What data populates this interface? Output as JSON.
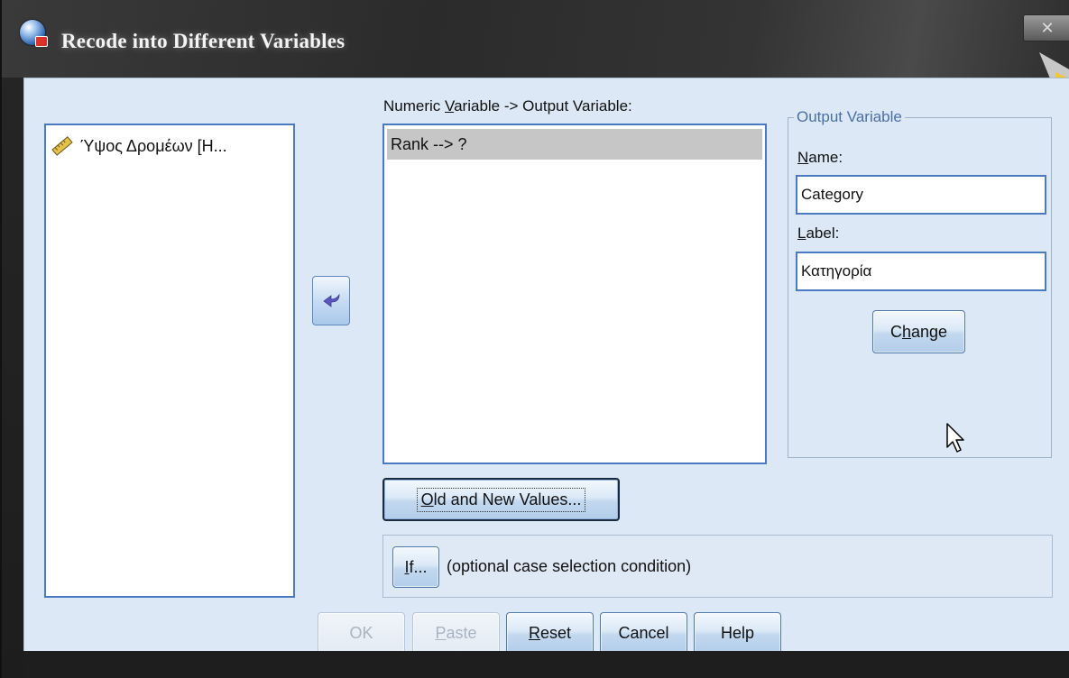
{
  "window": {
    "title": "Recode into Different Variables",
    "close_label": "✕"
  },
  "source_list": {
    "items": [
      {
        "label": "Ύψος Δρομέων [H...",
        "icon": "scale-ruler-icon"
      }
    ]
  },
  "mapping": {
    "header_before": "Numeric ",
    "header_mnemonic": "V",
    "header_after": "ariable -> Output Variable:",
    "rows": [
      "Rank --> ?"
    ]
  },
  "output_variable": {
    "group_title": "Output Variable",
    "name_mnemonic": "N",
    "name_rest": "ame:",
    "name_value": "Category",
    "label_mnemonic": "L",
    "label_rest": "abel:",
    "label_value": "Κατηγορία",
    "change_pre": "C",
    "change_mnemonic": "h",
    "change_post": "ange"
  },
  "buttons": {
    "old_new_mnemonic": "O",
    "old_new_rest": "ld and New Values...",
    "if_mnemonic": "I",
    "if_rest": "f...",
    "if_caption": "(optional case selection condition)",
    "ok": "OK",
    "paste_mnemonic": "P",
    "paste_rest": "aste",
    "reset_mnemonic": "R",
    "reset_rest": "eset",
    "cancel": "Cancel",
    "help": "Help"
  },
  "colors": {
    "dialog_bg": "#dce8f5",
    "list_border": "#4a7ac4",
    "selected_row": "#c6c6c6",
    "group_title": "#4a6fa5"
  }
}
